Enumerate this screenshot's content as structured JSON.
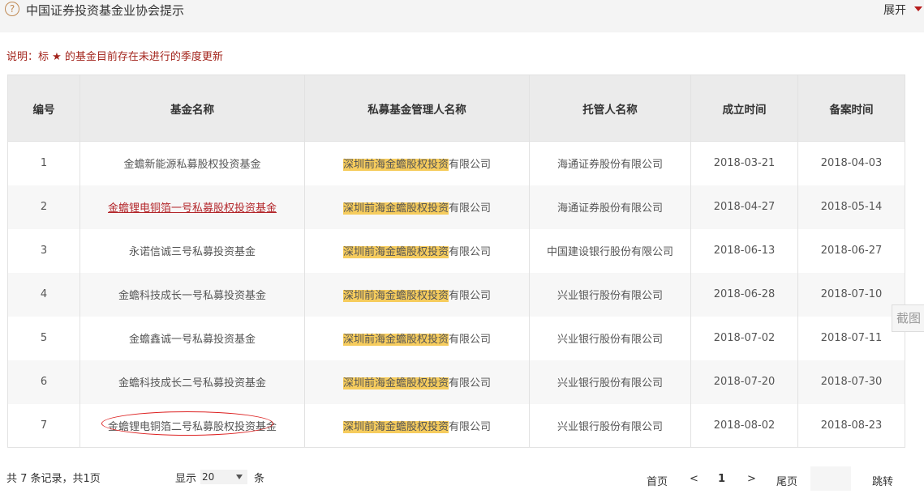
{
  "topbar": {
    "help_icon": "?",
    "title": "中国证券投资基金业协会提示",
    "expand_label": "展开"
  },
  "note": "说明：标 ★ 的基金目前存在未进行的季度更新",
  "table": {
    "headers": [
      "编号",
      "基金名称",
      "私募基金管理人名称",
      "托管人名称",
      "成立时间",
      "备案时间"
    ],
    "rows": [
      {
        "no": "1",
        "fund": "金蟾新能源私募股权投资基金",
        "manager_hl": "深圳前海金蟾股权投资",
        "manager_rest": "有限公司",
        "custodian": "海通证券股份有限公司",
        "established": "2018-03-21",
        "filed": "2018-04-03"
      },
      {
        "no": "2",
        "fund": "金蟾锂电铜箔一号私募股权投资基金",
        "manager_hl": "深圳前海金蟾股权投资",
        "manager_rest": "有限公司",
        "custodian": "海通证券股份有限公司",
        "established": "2018-04-27",
        "filed": "2018-05-14"
      },
      {
        "no": "3",
        "fund": "永诺信诚三号私募投资基金",
        "manager_hl": "深圳前海金蟾股权投资",
        "manager_rest": "有限公司",
        "custodian": "中国建设银行股份有限公司",
        "established": "2018-06-13",
        "filed": "2018-06-27"
      },
      {
        "no": "4",
        "fund": "金蟾科技成长一号私募投资基金",
        "manager_hl": "深圳前海金蟾股权投资",
        "manager_rest": "有限公司",
        "custodian": "兴业银行股份有限公司",
        "established": "2018-06-28",
        "filed": "2018-07-10"
      },
      {
        "no": "5",
        "fund": "金蟾鑫诚一号私募投资基金",
        "manager_hl": "深圳前海金蟾股权投资",
        "manager_rest": "有限公司",
        "custodian": "兴业银行股份有限公司",
        "established": "2018-07-02",
        "filed": "2018-07-11"
      },
      {
        "no": "6",
        "fund": "金蟾科技成长二号私募投资基金",
        "manager_hl": "深圳前海金蟾股权投资",
        "manager_rest": "有限公司",
        "custodian": "兴业银行股份有限公司",
        "established": "2018-07-20",
        "filed": "2018-07-30"
      },
      {
        "no": "7",
        "fund": "金蟾锂电铜箔二号私募股权投资基金",
        "manager_hl": "深圳前海金蟾股权投资",
        "manager_rest": "有限公司",
        "custodian": "兴业银行股份有限公司",
        "established": "2018-08-02",
        "filed": "2018-08-23"
      }
    ]
  },
  "side_tab": "截图",
  "footer": {
    "total": "共 7 条记录，共1页",
    "show_label": "显示",
    "page_size": "20",
    "unit": "条",
    "first": "首页",
    "prev": "<",
    "current_page": "1",
    "next": ">",
    "last": "尾页",
    "go": "跳转"
  },
  "colors": {
    "accent_red": "#a3251d",
    "highlight": "#f6cc5d",
    "header_bg": "#ebebeb"
  }
}
